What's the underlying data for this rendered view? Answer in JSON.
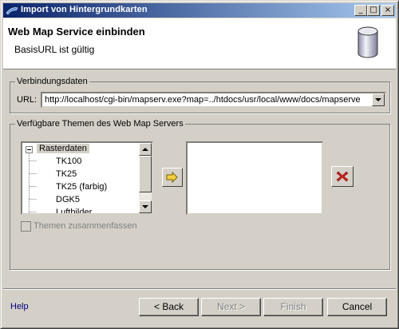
{
  "window": {
    "title": "Import von Hintergrundkarten"
  },
  "titlebar_buttons": {
    "minimize": "_",
    "maximize": "□",
    "close": "×"
  },
  "banner": {
    "title": "Web Map Service einbinden",
    "message": "BasisURL ist gültig",
    "icon": "database-icon"
  },
  "connection": {
    "group_label": "Verbindungsdaten",
    "url_label": "URL:",
    "url_value": "http://localhost/cgi-bin/mapserv.exe?map=../htdocs/usr/local/www/docs/mapserve"
  },
  "themes": {
    "group_label": "Verfügbare Themen des Web Map Servers",
    "tree_root": "Rasterdaten",
    "tree_root_toggle": "−",
    "tree_items": [
      "TK100",
      "TK25",
      "TK25 (farbig)",
      "DGK5",
      "Luftbilder"
    ],
    "merge_checkbox_label": "Themen zusammenfassen",
    "add_icon": "arrow-right-icon",
    "remove_icon": "red-x-icon"
  },
  "footer": {
    "help": "Help",
    "back": "< Back",
    "next": "Next >",
    "finish": "Finish",
    "cancel": "Cancel"
  },
  "colors": {
    "titlebar_start": "#0a246a",
    "titlebar_end": "#a6caf0",
    "remove_red": "#d42020",
    "add_yellow": "#f2d040"
  }
}
